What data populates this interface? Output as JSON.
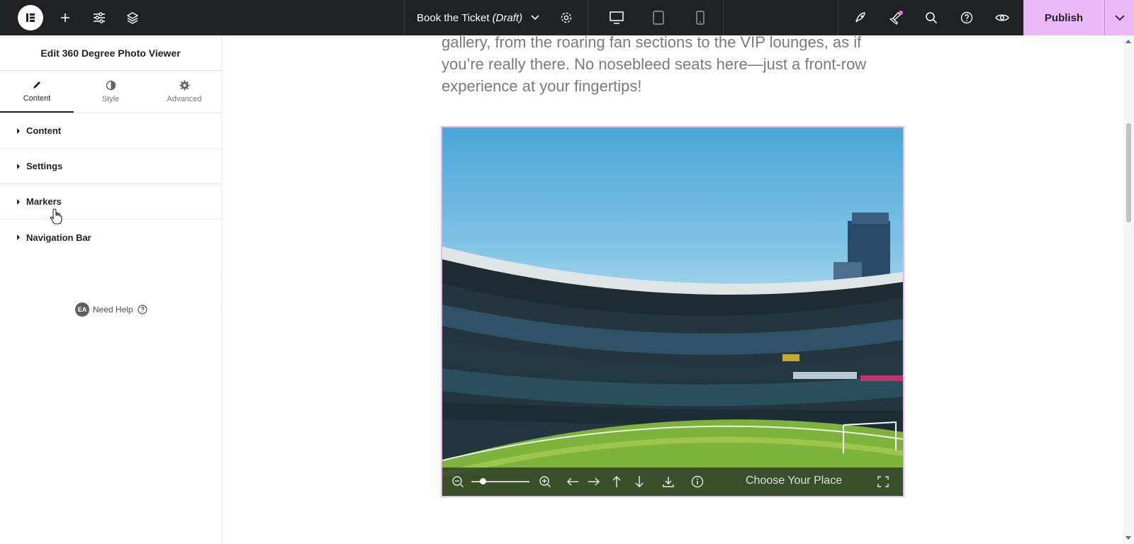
{
  "topbar": {
    "doc_title": "Book the Ticket",
    "doc_status": "(Draft)",
    "publish_label": "Publish",
    "icons": [
      "elementor-logo-icon",
      "add-icon",
      "settings-sliders-icon",
      "layers-icon",
      "chevron-down-icon",
      "gear-icon",
      "desktop-icon",
      "tablet-icon",
      "mobile-icon",
      "rocket-icon",
      "notifications-icon",
      "search-icon",
      "help-icon",
      "preview-eye-icon"
    ],
    "accent_color": "#e9b8f5"
  },
  "panel": {
    "title": "Edit 360 Degree Photo Viewer",
    "tabs": [
      {
        "label": "Content",
        "icon": "pencil-icon",
        "active": true
      },
      {
        "label": "Style",
        "icon": "contrast-icon",
        "active": false
      },
      {
        "label": "Advanced",
        "icon": "gear-icon",
        "active": false
      }
    ],
    "sections": [
      "Content",
      "Settings",
      "Markers",
      "Navigation Bar"
    ],
    "help": {
      "badge": "EA",
      "label": "Need Help"
    }
  },
  "canvas": {
    "paragraph": "gallery, from the roaring fan sections to the VIP lounges, as if you’re really there. No nosebleed seats here—just a front-row experience at your fingertips!",
    "viewer": {
      "caption": "Choose Your Place",
      "zoom_level": 0.2,
      "controls": [
        "zoom-out-icon",
        "zoom-slider",
        "zoom-in-icon",
        "arrow-left-icon",
        "arrow-right-icon",
        "arrow-up-icon",
        "arrow-down-icon",
        "download-icon",
        "info-icon",
        "fullscreen-icon"
      ]
    }
  }
}
